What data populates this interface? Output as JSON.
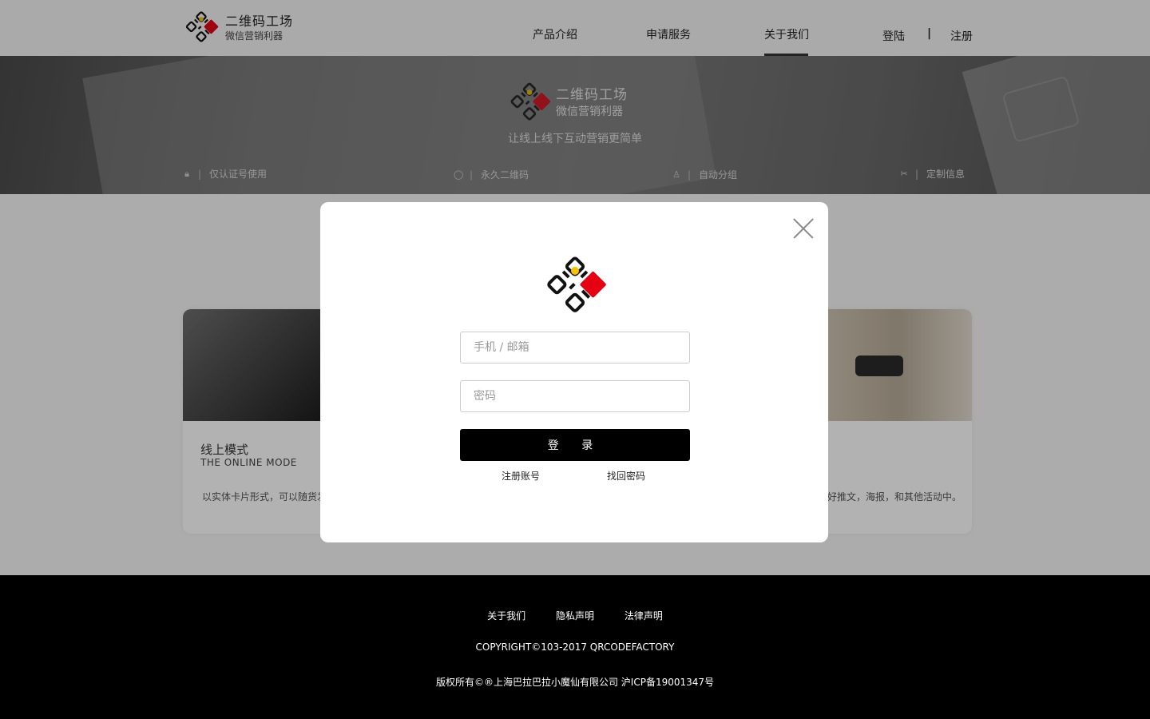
{
  "header": {
    "logo": {
      "title": "二维码工场",
      "subtitle": "微信营销利器"
    },
    "nav": {
      "items": [
        {
          "label": "产品介绍"
        },
        {
          "label": "申请服务"
        },
        {
          "label": "关于我们",
          "active": true
        }
      ]
    },
    "auth": {
      "login": "登陆",
      "separator": "|",
      "register": "注册"
    }
  },
  "banner": {
    "logo": {
      "title": "二维码工场",
      "subtitle": "微信营销利器"
    },
    "slogan": "让线上线下互动营销更简单",
    "features": [
      {
        "icon": "lock-icon",
        "label": "仅认证号使用"
      },
      {
        "icon": "circle-icon",
        "label": "永久二维码"
      },
      {
        "icon": "group-icon",
        "label": "自动分组"
      },
      {
        "icon": "tools-icon",
        "label": "定制信息"
      }
    ]
  },
  "cards": [
    {
      "title": "线上模式",
      "subtitle": "THE ONLINE MODE",
      "desc": "以实体卡片形式，可以随货发"
    },
    {
      "desc": "好推文，海报，和其他活动中。"
    }
  ],
  "modal": {
    "phone_placeholder": "手机 / 邮箱",
    "password_placeholder": "密码",
    "login_button": "登 录",
    "register_link": "注册账号",
    "forgot_link": "找回密码"
  },
  "footer": {
    "links": [
      "关于我们",
      "隐私声明",
      "法律声明"
    ],
    "copyright": "COPYRIGHT©103-2017 QRCODEFACTORY",
    "icp": "版权所有©®上海巴拉巴拉小魔仙有限公司 沪ICP备19001347号"
  },
  "colors": {
    "brand_red": "#e60012",
    "brand_yellow": "#f5c400",
    "footer_bg": "#000000"
  }
}
